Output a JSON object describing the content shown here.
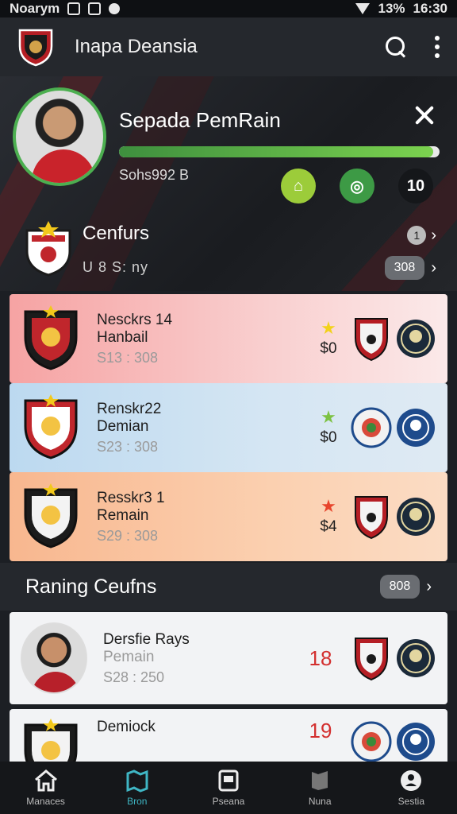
{
  "status_bar": {
    "left_text": "Noarym",
    "right_text": "13%",
    "time": "16:30"
  },
  "app_bar": {
    "title": "Inapa Deansia"
  },
  "hero": {
    "player_name": "Sepada PemRain",
    "progress": 0.98,
    "subtitle": "Sohs992 B",
    "badge_value": "10"
  },
  "club": {
    "title": "Cenfurs",
    "subtitle": "U 8 S: ny",
    "small_pill": "1",
    "pill": "308"
  },
  "cards": [
    {
      "name": "Nesckrs 14",
      "sub": "Hanbail",
      "num": "S13 : 308",
      "price": "$0",
      "star_color": "#f2d21b",
      "bg": "linear-gradient(90deg,#f6a3a3,#f9d0d0 60%,#fbe9e9)",
      "star": "★"
    },
    {
      "name": "Renskr22",
      "sub": "Demian",
      "num": "S23 : 308",
      "price": "$0",
      "star_color": "#7cc242",
      "bg": "linear-gradient(90deg,#bcd9f0,#d5e6f3 60%,#dfeaf3)",
      "star": "★"
    },
    {
      "name": "Resskr3 1",
      "sub": "Remain",
      "num": "S29 : 308",
      "price": "$4",
      "star_color": "#e8452c",
      "bg": "linear-gradient(90deg,#f8b78f,#fbd0b0 60%,#fbdcc4)",
      "star": "★"
    }
  ],
  "section": {
    "title": "Raning Ceufns",
    "pill": "808"
  },
  "ranking": [
    {
      "name": "Dersfie Rays",
      "sub": "Pemain",
      "num": "S28 : 250",
      "score": "18"
    },
    {
      "name": "Demiock",
      "sub": "",
      "num": "",
      "score": "19"
    }
  ],
  "nav": [
    {
      "label": "Manaces",
      "icon": "home-icon"
    },
    {
      "label": "Bron",
      "icon": "map-icon"
    },
    {
      "label": "Pseana",
      "icon": "card-icon"
    },
    {
      "label": "Nuna",
      "icon": "flag-icon"
    },
    {
      "label": "Sestia",
      "icon": "profile-icon"
    }
  ]
}
